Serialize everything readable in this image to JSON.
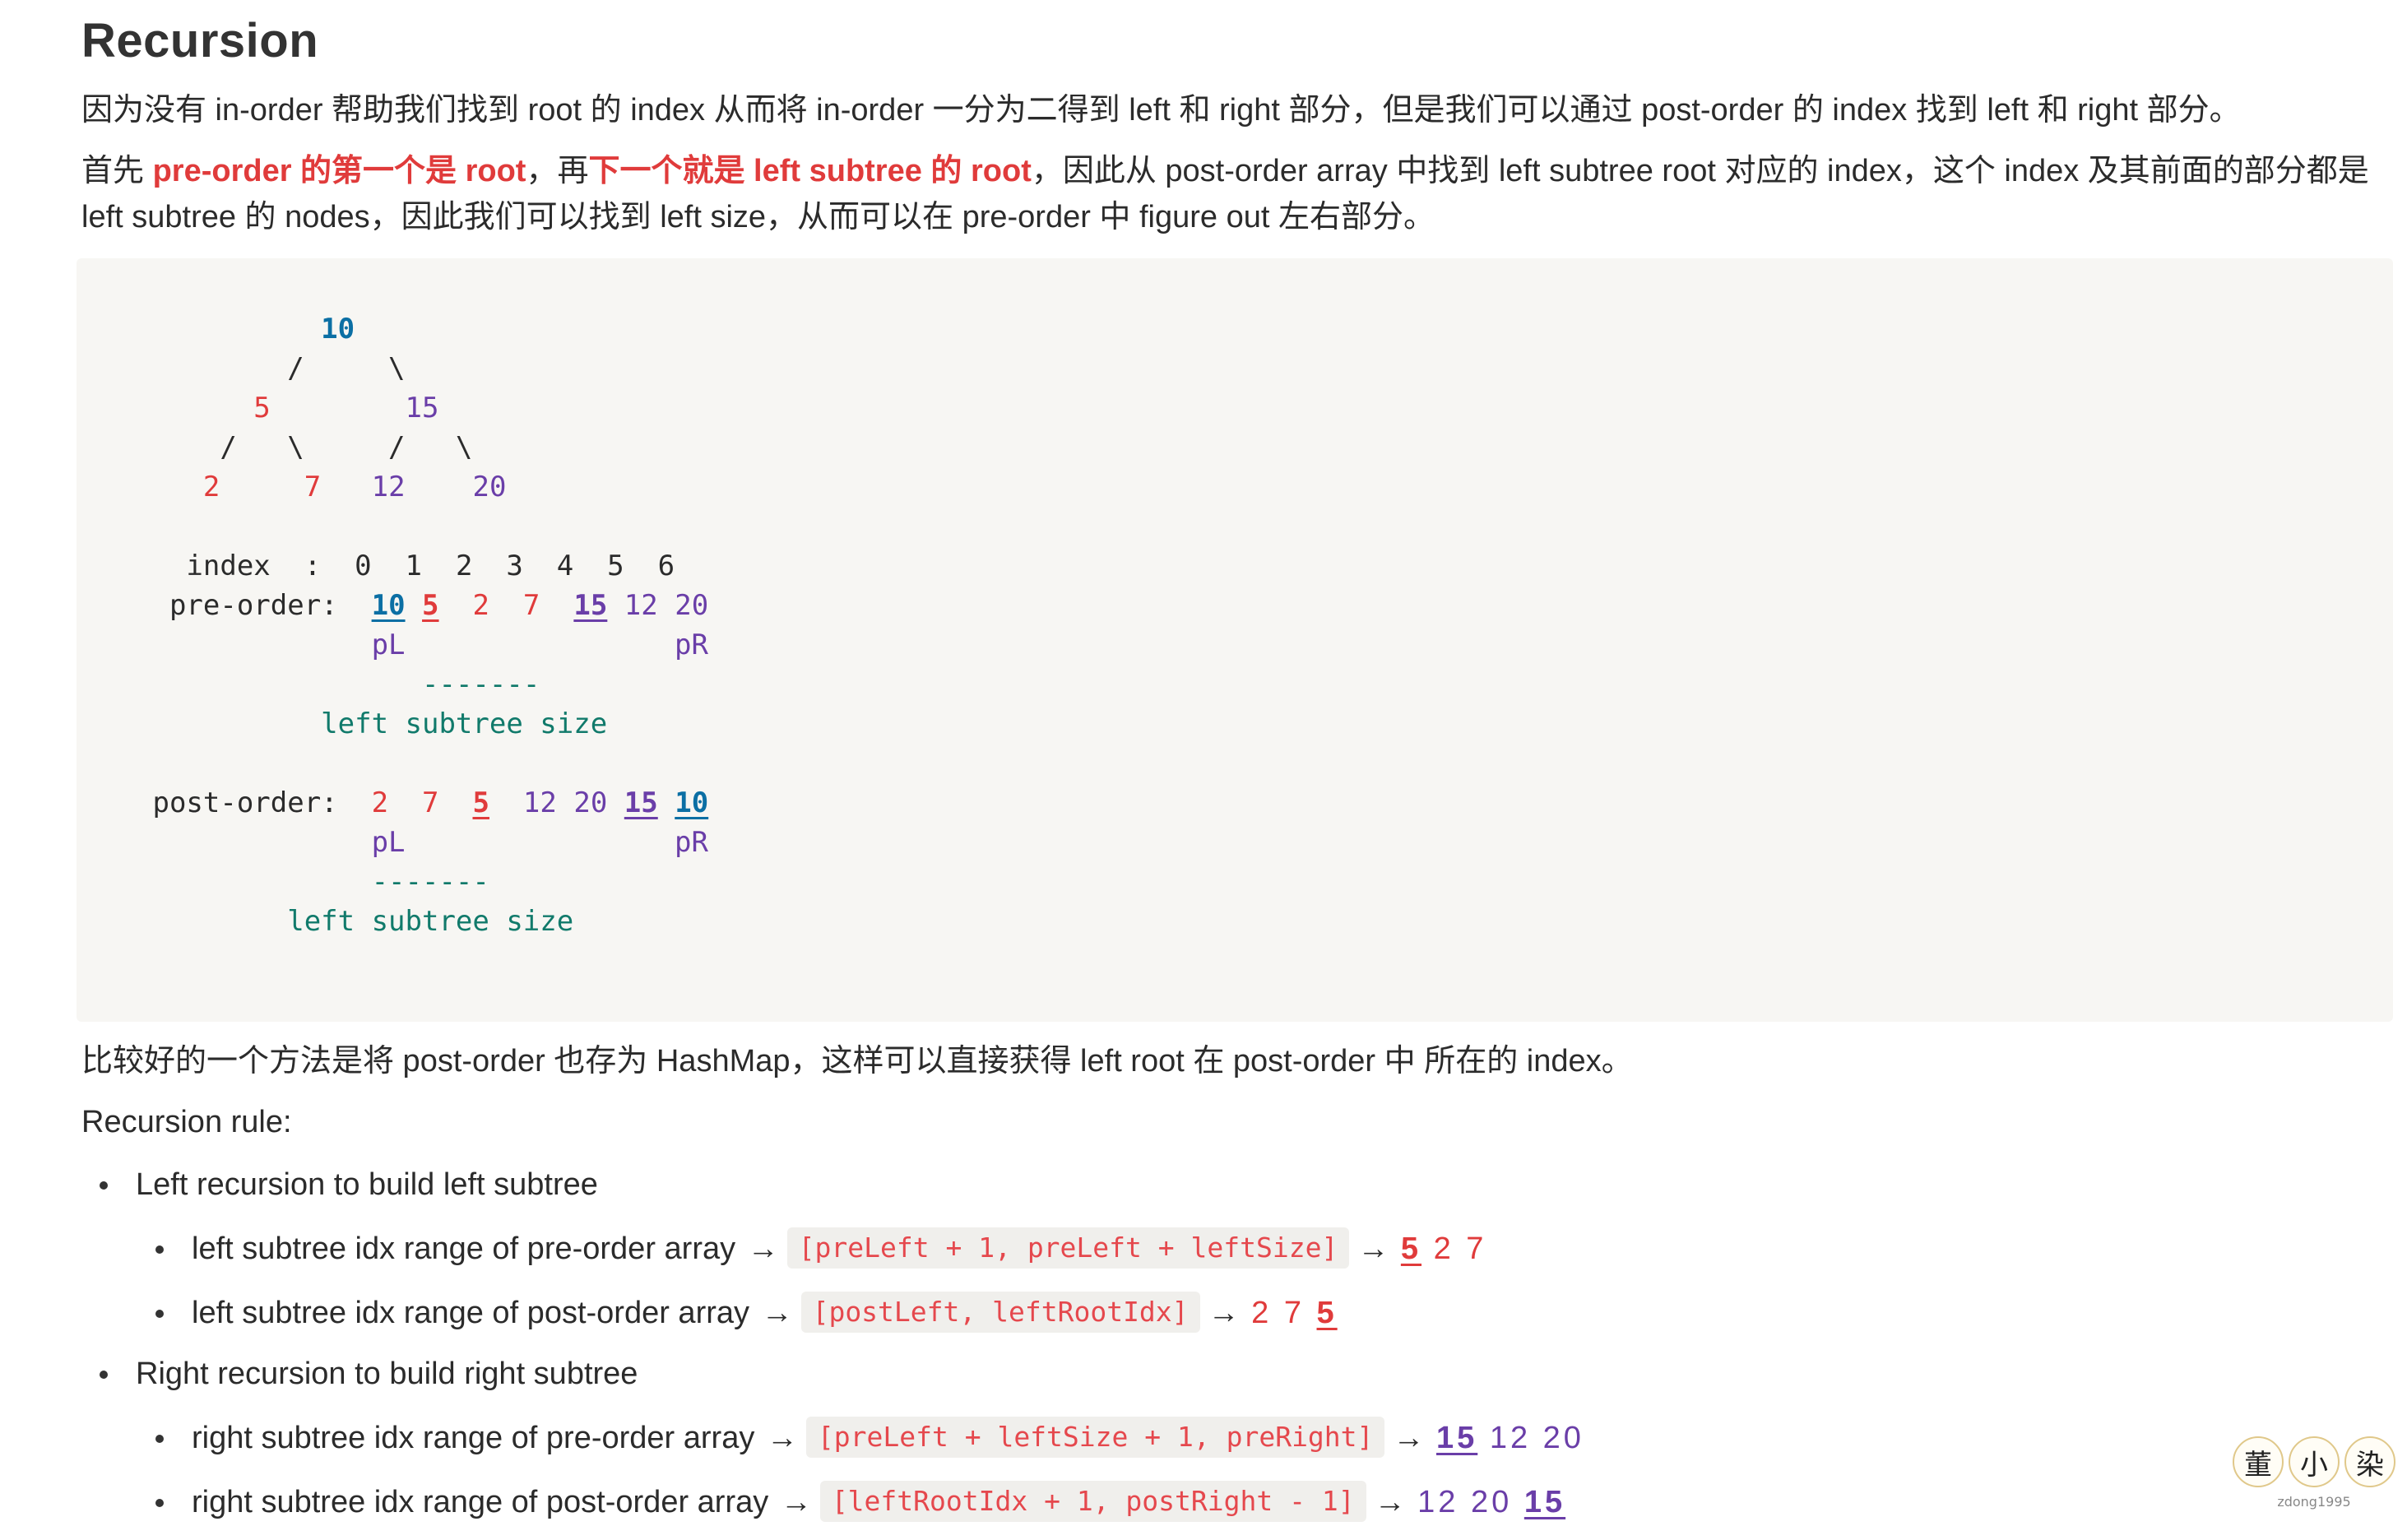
{
  "title": "Recursion",
  "para1": "因为没有 in-order 帮助我们找到 root 的 index 从而将 in-order 一分为二得到 left 和 right 部分，但是我们可以通过 post-order 的 index 找到 left 和 right 部分。",
  "para2": {
    "t1": "首先 ",
    "t2": "pre-order 的第一个是 root",
    "t3": "，再",
    "t4": "下一个就是 left subtree 的 root",
    "t5": "，因此从 post-order array 中找到 left subtree root 对应的 index，这个 index 及其前面的部分都是 left subtree 的 nodes，因此我们可以找到 left size，从而可以在 pre-order 中 figure out 左右部分。"
  },
  "diagram": {
    "root": "10",
    "left": "5",
    "right": "15",
    "ll": "2",
    "lr": "7",
    "rl": "12",
    "rr": "20",
    "index_label": "index  :",
    "index_values": "0  1  2  3  4  5  6",
    "pre_label": "pre-order:",
    "pre_values": [
      "10",
      "5",
      "2",
      "7",
      "15",
      "12",
      "20"
    ],
    "post_label": "post-order:",
    "post_values": [
      "2",
      "7",
      "5",
      "12",
      "20",
      "15",
      "10"
    ],
    "pL": "pL",
    "pR": "pR",
    "dashes": "-------",
    "subtree_label": "left subtree size"
  },
  "para3": "比较好的一个方法是将 post-order 也存为 HashMap，这样可以直接获得 left root 在 post-order 中 所在的 index。",
  "para4": "Recursion rule:",
  "rules": [
    {
      "label": "Left recursion to build left subtree",
      "items": [
        {
          "text": "left subtree idx range of pre-order array",
          "code": "[preLeft + 1, preLeft + leftSize]",
          "result": [
            "5",
            "2",
            "7"
          ]
        },
        {
          "text": "left subtree idx range of post-order array",
          "code": "[postLeft, leftRootIdx]",
          "result": [
            "2",
            "7",
            "5"
          ]
        }
      ]
    },
    {
      "label": "Right recursion to build right subtree",
      "items": [
        {
          "text": "right subtree idx range of pre-order array",
          "code": "[preLeft + leftSize + 1, preRight]",
          "result": [
            "15",
            "12",
            "20"
          ]
        },
        {
          "text": "right subtree idx range of post-order array",
          "code": "[leftRootIdx + 1, postRight - 1]",
          "result": [
            "12",
            "20",
            "15"
          ]
        }
      ]
    }
  ],
  "arrow": "→",
  "watermark": {
    "chars": [
      "董",
      "小",
      "染"
    ],
    "sub": "zdong1995"
  }
}
